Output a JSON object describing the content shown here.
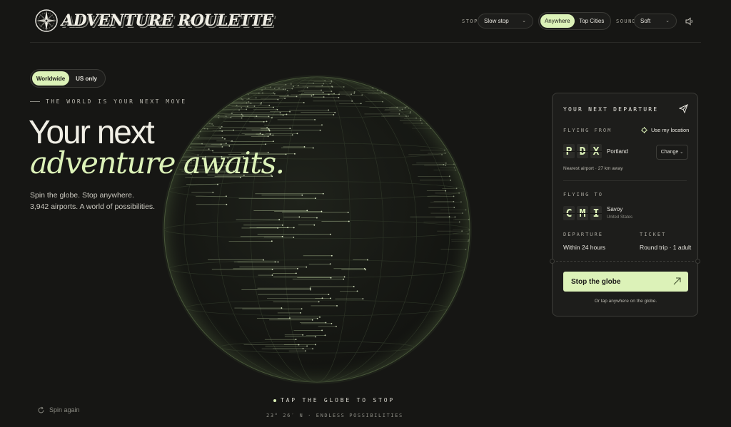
{
  "header": {
    "logo_text": "ADVENTURE ROULETTE",
    "stop_label": "STOP",
    "stop_value": "Slow stop",
    "destination_options": [
      {
        "label": "Anywhere",
        "active": true
      },
      {
        "label": "Top Cities",
        "active": false
      }
    ],
    "sound_label": "SOUND",
    "sound_value": "Soft"
  },
  "region_toggle": [
    {
      "label": "Worldwide",
      "active": true
    },
    {
      "label": "US only",
      "active": false
    }
  ],
  "hero": {
    "eyebrow": "THE WORLD IS YOUR NEXT MOVE",
    "headline_line1": "Your next",
    "headline_line2": "adventure awaits.",
    "subtext_line1": "Spin the globe. Stop anywhere.",
    "subtext_line2": "3,942 airports. A world of possibilities."
  },
  "bottom": {
    "spin_again": "Spin again",
    "tap_hint": "TAP THE GLOBE TO STOP",
    "coords": "23° 26′ N · ENDLESS POSSIBILITIES"
  },
  "card": {
    "title": "YOUR NEXT DEPARTURE",
    "flying_from_label": "FLYING FROM",
    "use_location": "Use my location",
    "from_code": [
      "P",
      "D",
      "X"
    ],
    "from_city": "Portland",
    "change_label": "Change",
    "nearest_airport": "Nearest airport · 27 km away",
    "flying_to_label": "FLYING TO",
    "to_code": [
      "C",
      "M",
      "I"
    ],
    "to_city": "Savoy",
    "to_country": "United States",
    "departure_label": "DEPARTURE",
    "departure_value": "Within 24 hours",
    "ticket_label": "TICKET",
    "ticket_value": "Round trip · 1 adult",
    "stop_button": "Stop the globe",
    "tap_anywhere": "Or tap anywhere on the globe."
  },
  "colors": {
    "accent": "#dcf2b8",
    "background": "#161614",
    "card": "#1d1d1b"
  }
}
